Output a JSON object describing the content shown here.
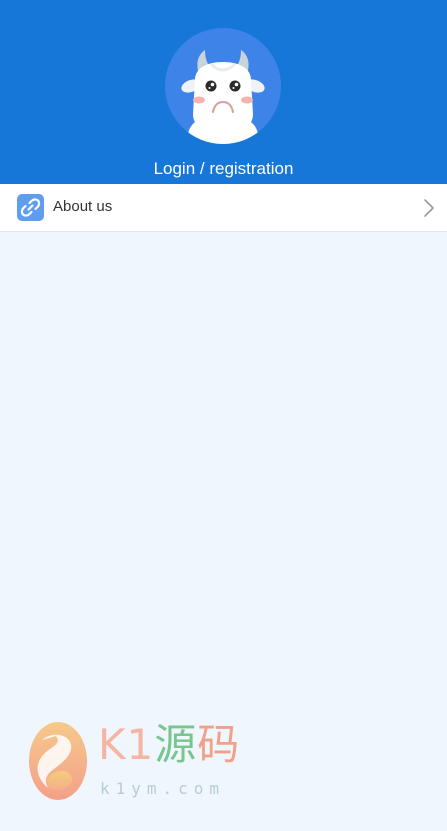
{
  "header": {
    "login_label": "Login / registration",
    "avatar_icon": "cow-avatar-icon",
    "background_color": "#1777d8"
  },
  "menu": {
    "items": [
      {
        "label": "About us",
        "icon": "link-icon",
        "trailing_icon": "chevron-right-icon"
      }
    ]
  },
  "watermark": {
    "brand_latin": "K1",
    "brand_cn_1": "源",
    "brand_cn_2": "码",
    "domain": "k1ym.com"
  },
  "colors": {
    "accent": "#1777d8",
    "page_background": "#f0f6fd",
    "menu_icon_bg": "#5e9df0"
  }
}
